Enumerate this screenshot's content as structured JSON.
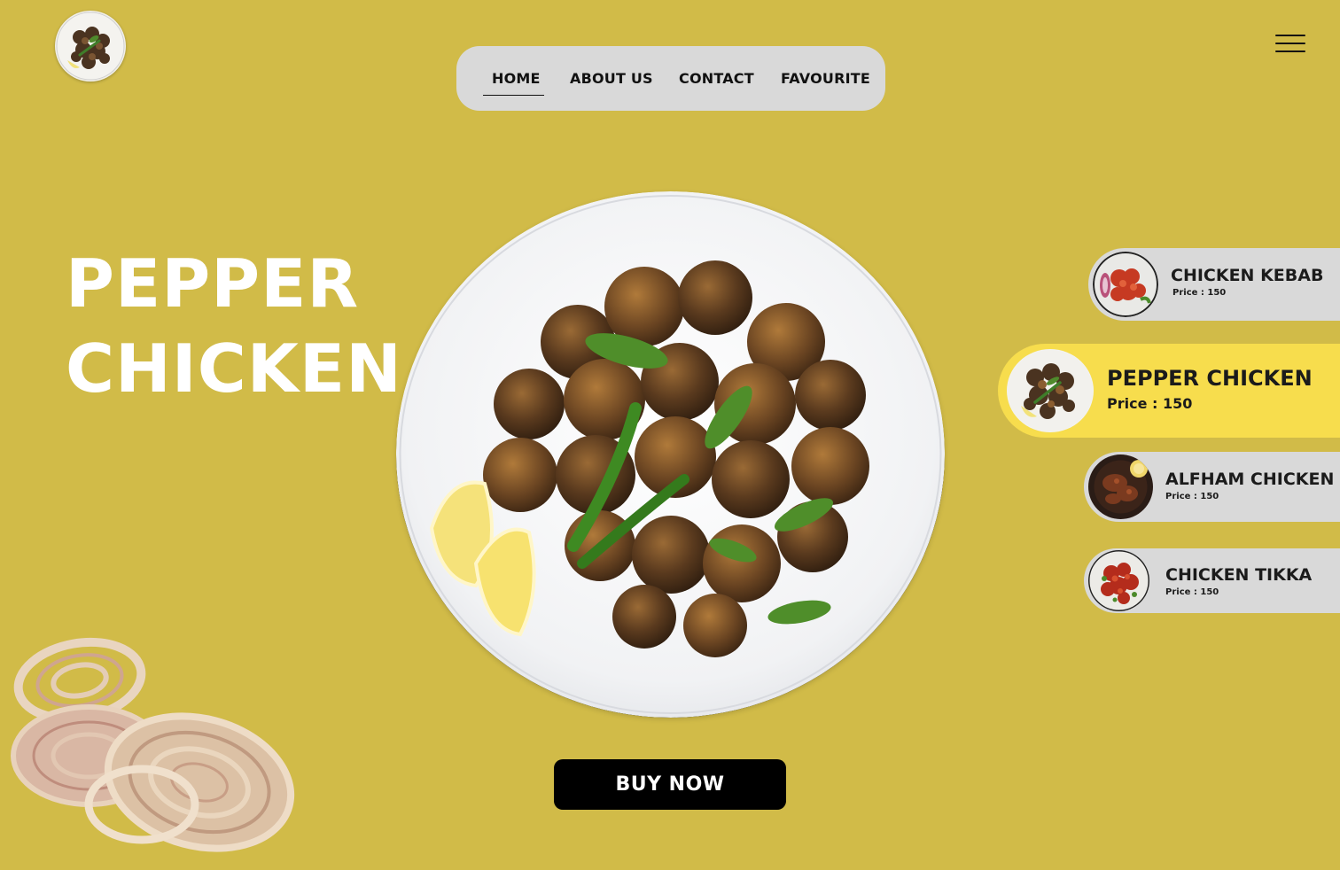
{
  "nav": {
    "items": [
      {
        "label": "HOME",
        "active": true
      },
      {
        "label": "ABOUT US",
        "active": false
      },
      {
        "label": "CONTACT",
        "active": false
      },
      {
        "label": "FAVOURITE",
        "active": false
      }
    ]
  },
  "hero": {
    "title_line1": "PEPPER",
    "title_line2": "CHICKEN",
    "buy_label": "BUY NOW"
  },
  "menu": {
    "items": [
      {
        "name": "CHICKEN KEBAB",
        "price": "Price : 150",
        "selected": false
      },
      {
        "name": "PEPPER CHICKEN",
        "price": "Price : 150",
        "selected": true
      },
      {
        "name": "ALFHAM CHICKEN",
        "price": "Price : 150",
        "selected": false
      },
      {
        "name": "CHICKEN TIKKA",
        "price": "Price : 150",
        "selected": false
      }
    ]
  },
  "icons": {
    "menu": "hamburger-menu-icon",
    "logo": "pepper-chicken-logo",
    "decoration": "onion-rings-illustration"
  },
  "colors": {
    "background": "#d1bb48",
    "nav_background": "#d9d9d9",
    "card_background": "#d9d9d9",
    "selected_card": "#f7dd4d",
    "button": "#000000",
    "hero_text": "#ffffff"
  }
}
